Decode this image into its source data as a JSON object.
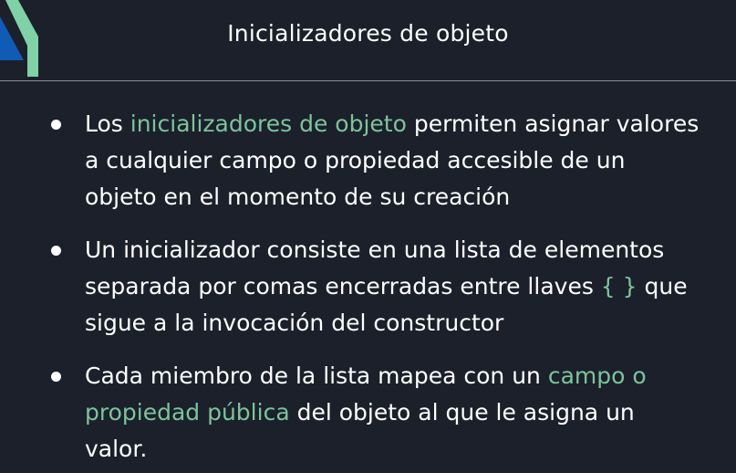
{
  "slide": {
    "title": "Inicializadores de objeto",
    "accent_color": "#7cc49a",
    "logo_colors": [
      "#0f5bb5",
      "#7fd1a6"
    ],
    "bullets": [
      {
        "pre": "Los ",
        "highlight": "inicializadores de objeto",
        "post": " permiten asignar valores a cualquier campo o propiedad accesible de un objeto en el momento de su creación"
      },
      {
        "pre": "Un inicializador consiste en una lista de elementos separada por comas encerradas entre llaves ",
        "highlight": "{ }",
        "post": " que sigue a la invocación del constructor"
      },
      {
        "pre": "Cada miembro de la lista mapea con un ",
        "highlight": "campo o propiedad pública",
        "post": " del objeto al que le asigna un valor."
      }
    ]
  }
}
